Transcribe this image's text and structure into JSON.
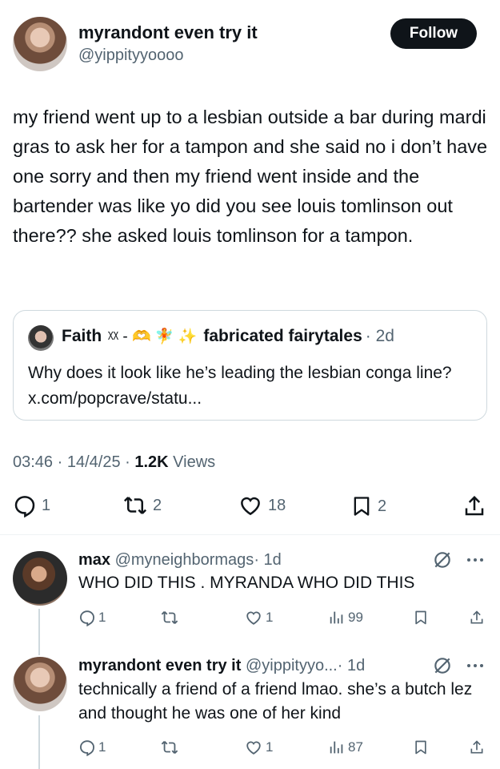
{
  "post": {
    "author_name": "myrandont even try it",
    "author_handle": "@yippityyoooo",
    "follow_label": "Follow",
    "text": "my friend went up to a lesbian outside a bar during mardi gras to ask her for a tampon and she said no i don’t have one sorry and then my friend went inside and the bartender was like yo did you see louis tomlinson out there?? she asked louis tomlinson for a tampon.",
    "quote": {
      "author_name_prefix": "Faith",
      "author_deco": "ᵡᵡ - 🫶 🧚 ✨",
      "author_name_suffix": "fabricated fairytales",
      "age": "· 2d",
      "text": "Why does it look like he’s leading the lesbian conga line? x.com/popcrave/statu..."
    },
    "time": "03:46",
    "date": "14/4/25",
    "views_count": "1.2K",
    "views_label": "Views",
    "replies": "1",
    "reposts": "2",
    "likes": "18",
    "bookmarks": "2"
  },
  "replies": [
    {
      "author_name": "max",
      "author_handle": "@myneighbormags",
      "age": "· 1d",
      "text": "WHO DID THIS . MYRANDA WHO DID THIS",
      "replies": "1",
      "likes": "1",
      "views": "99"
    },
    {
      "author_name": "myrandont even try it",
      "author_handle": "@yippityyo...",
      "age": "· 1d",
      "text": "technically a friend of a friend lmao. she’s a butch lez and thought he was one of her kind",
      "replies": "1",
      "likes": "1",
      "views": "87"
    }
  ],
  "icons": {
    "more": "more-icon",
    "grok": "grok-icon",
    "reply": "reply-icon",
    "repost": "repost-icon",
    "like": "like-icon",
    "bookmark": "bookmark-icon",
    "share": "share-icon",
    "views": "views-icon"
  },
  "colors": {
    "text": "#0f1419",
    "muted": "#536471",
    "border": "#cfd9de",
    "button": "#0f1419"
  }
}
